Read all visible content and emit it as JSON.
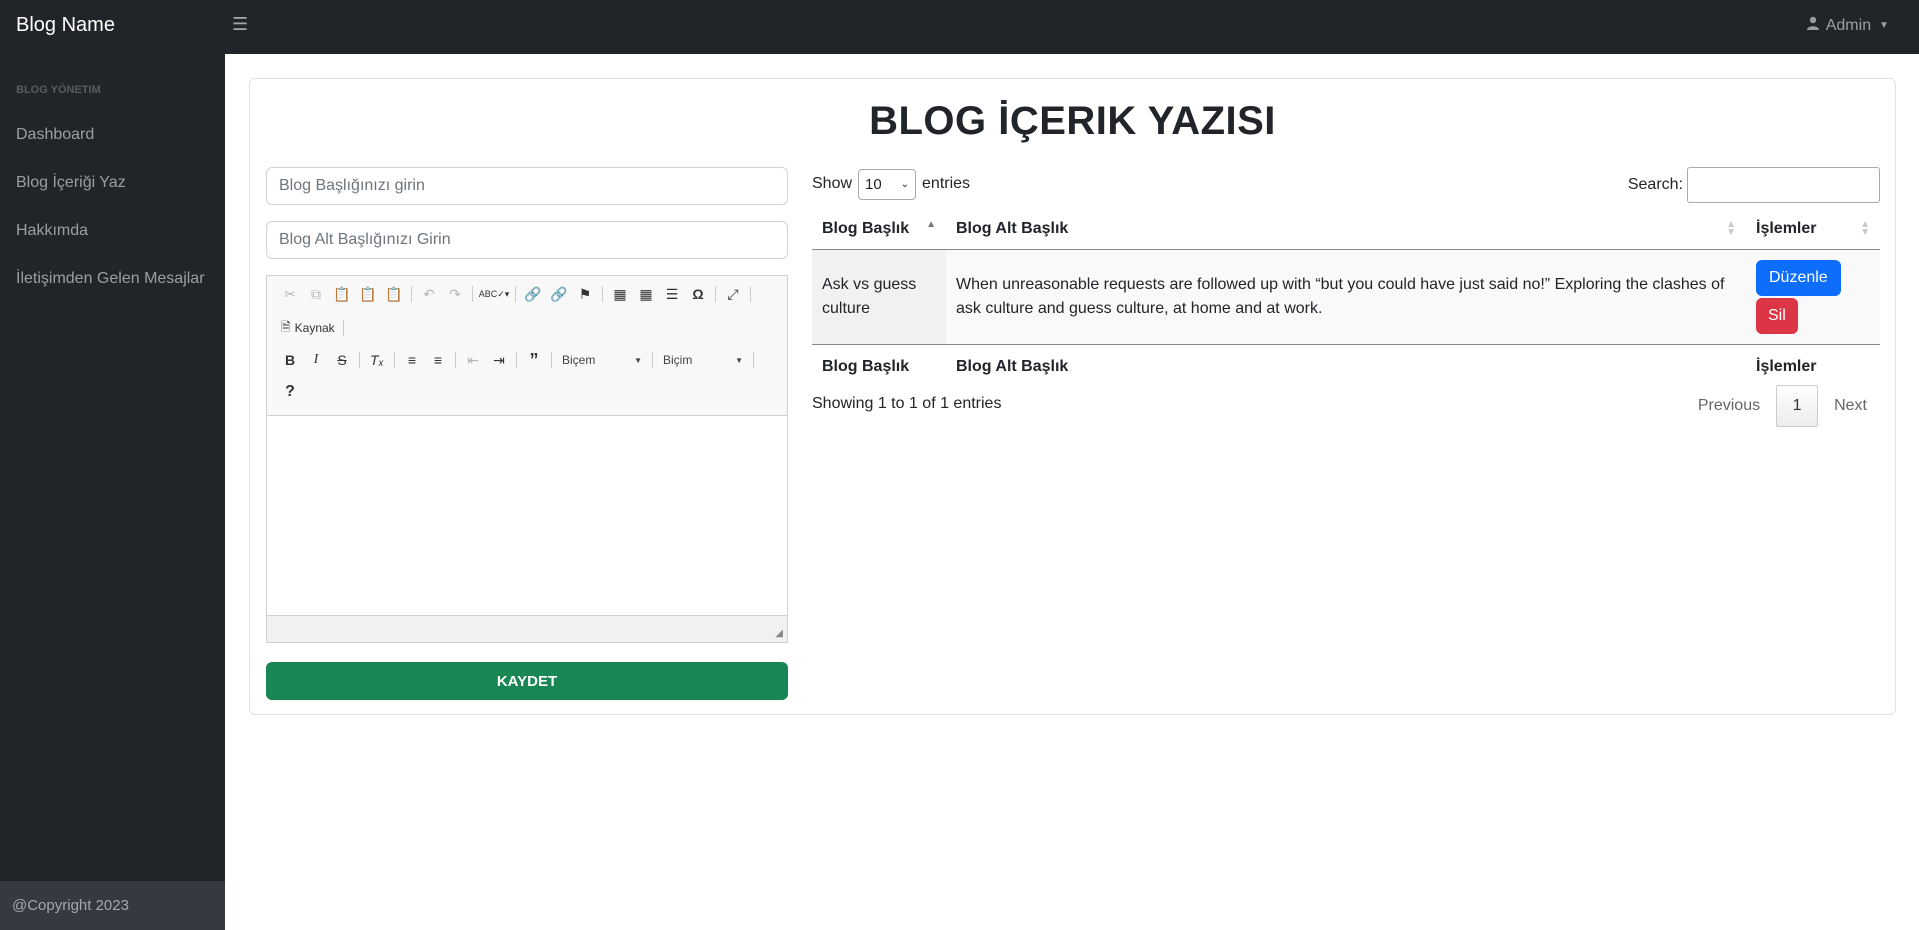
{
  "navbar": {
    "brand": "Blog Name",
    "toggle_icon": "menu-icon",
    "user": {
      "name": "Admin",
      "icon": "user-icon"
    }
  },
  "sidebar": {
    "heading": "BLOG YÖNETIM",
    "items": [
      {
        "label": "Dashboard"
      },
      {
        "label": "Blog İçeriği Yaz"
      },
      {
        "label": "Hakkımda"
      },
      {
        "label": "İletişimden Gelen Mesajlar"
      }
    ],
    "footer": "@Copyright 2023"
  },
  "page": {
    "title": "BLOG İÇERIK YAZISI"
  },
  "form": {
    "title_placeholder": "Blog Başlığınızı girin",
    "subtitle_placeholder": "Blog Alt Başlığınızı Girin",
    "editor": {
      "source_label": "Kaynak",
      "format_combo": "Biçem",
      "style_combo": "Biçim",
      "help_label": "?"
    },
    "save_label": "KAYDET"
  },
  "table": {
    "show_label": "Show",
    "page_length": "10",
    "entries_label": "entries",
    "search_label": "Search:",
    "search_value": "",
    "columns": [
      "Blog Başlık",
      "Blog Alt Başlık",
      "İşlemler"
    ],
    "rows": [
      {
        "title": "Ask vs guess culture",
        "subtitle": "When unreasonable requests are followed up with “but you could have just said no!” Exploring the clashes of ask culture and guess culture, at home and at work.",
        "edit_label": "Düzenle",
        "delete_label": "Sil"
      }
    ],
    "info": "Showing 1 to 1 of 1 entries",
    "pagination": {
      "previous": "Previous",
      "current": "1",
      "next": "Next"
    }
  },
  "colors": {
    "sidebar_bg": "#212529",
    "save": "#198754",
    "edit": "#0d6efd",
    "delete": "#dc3545"
  }
}
